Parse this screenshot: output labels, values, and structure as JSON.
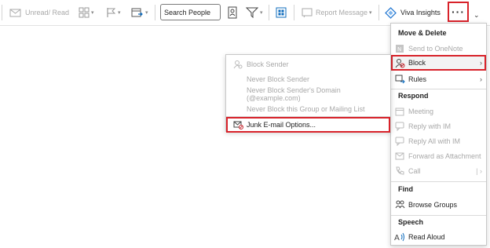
{
  "ribbon": {
    "unread_read": "Unread/ Read",
    "search_people": "Search People",
    "report_message": "Report Message",
    "viva_insights": "Viva Insights",
    "more_button": "···"
  },
  "main_menu": {
    "section_move_delete": "Move & Delete",
    "send_to_onenote": "Send to OneNote",
    "block": "Block",
    "rules": "Rules",
    "section_respond": "Respond",
    "meeting": "Meeting",
    "reply_with_im": "Reply with IM",
    "reply_all_with_im": "Reply All with IM",
    "forward_as_attachment": "Forward as Attachment",
    "call": "Call",
    "section_find": "Find",
    "browse_groups": "Browse Groups",
    "section_speech": "Speech",
    "read_aloud": "Read Aloud"
  },
  "block_submenu": {
    "block_sender": "Block Sender",
    "never_block_sender": "Never Block Sender",
    "never_block_domain": "Never Block Sender's Domain (@example.com)",
    "never_block_group": "Never Block this Group or Mailing List",
    "junk_options": "Junk E-mail Options..."
  },
  "colors": {
    "highlight": "#d8222a",
    "accent": "#0f6cbd",
    "disabled": "#a8a8a8"
  }
}
